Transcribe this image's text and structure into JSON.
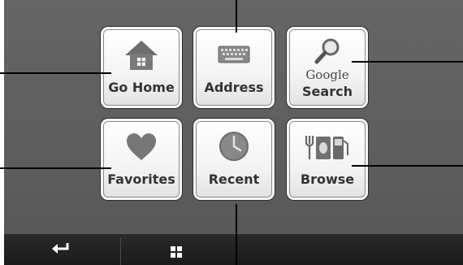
{
  "tiles": {
    "go_home": {
      "label": "Go Home"
    },
    "address": {
      "label": "Address"
    },
    "google_search": {
      "brand": "Google",
      "label": "Search"
    },
    "favorites": {
      "label": "Favorites"
    },
    "recent": {
      "label": "Recent"
    },
    "browse": {
      "label": "Browse"
    }
  },
  "bottom_bar": {
    "back_icon": "return-arrow-icon",
    "menu_icon": "grid-icon"
  },
  "colors": {
    "screen": "#606060",
    "tile": "#f5f5f5",
    "icon": "#777777",
    "bar": "#222222"
  }
}
